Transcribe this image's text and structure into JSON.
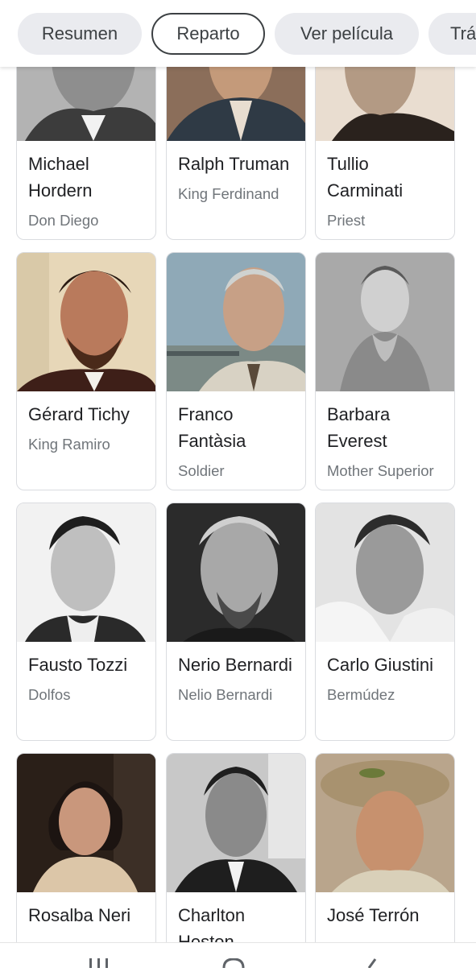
{
  "tabs": [
    {
      "label": "Resumen",
      "active": false
    },
    {
      "label": "Reparto",
      "active": true
    },
    {
      "label": "Ver película",
      "active": false
    },
    {
      "label": "Trá",
      "active": false
    }
  ],
  "cast": [
    {
      "name": "Michael Hordern",
      "role": "Don Diego",
      "photo": "grayscale portrait"
    },
    {
      "name": "Ralph Truman",
      "role": "King Ferdinand",
      "photo": "color portrait"
    },
    {
      "name": "Tullio Carminati",
      "role": "Priest",
      "photo": "sepia portrait"
    },
    {
      "name": "Gérard Tichy",
      "role": "King Ramiro",
      "photo": "color portrait"
    },
    {
      "name": "Franco Fantàsia",
      "role": "Soldier",
      "photo": "color portrait"
    },
    {
      "name": "Barbara Everest",
      "role": "Mother Superior",
      "photo": "grayscale portrait"
    },
    {
      "name": "Fausto Tozzi",
      "role": "Dolfos",
      "photo": "grayscale portrait"
    },
    {
      "name": "Nerio Bernardi",
      "role": "Nelio Bernardi",
      "photo": "grayscale portrait"
    },
    {
      "name": "Carlo Giustini",
      "role": "Bermúdez",
      "photo": "grayscale portrait"
    },
    {
      "name": "Rosalba Neri",
      "role": "",
      "photo": "color portrait"
    },
    {
      "name": "Charlton Heston",
      "role": "",
      "photo": "grayscale portrait"
    },
    {
      "name": "José Terrón",
      "role": "",
      "photo": "color portrait"
    }
  ],
  "navbar": {
    "icons": [
      "recent-apps-icon",
      "home-icon",
      "back-icon"
    ]
  },
  "colors": {
    "chip_bg": "#eaebef",
    "card_border": "#dadce0",
    "role_text": "#70757a"
  }
}
